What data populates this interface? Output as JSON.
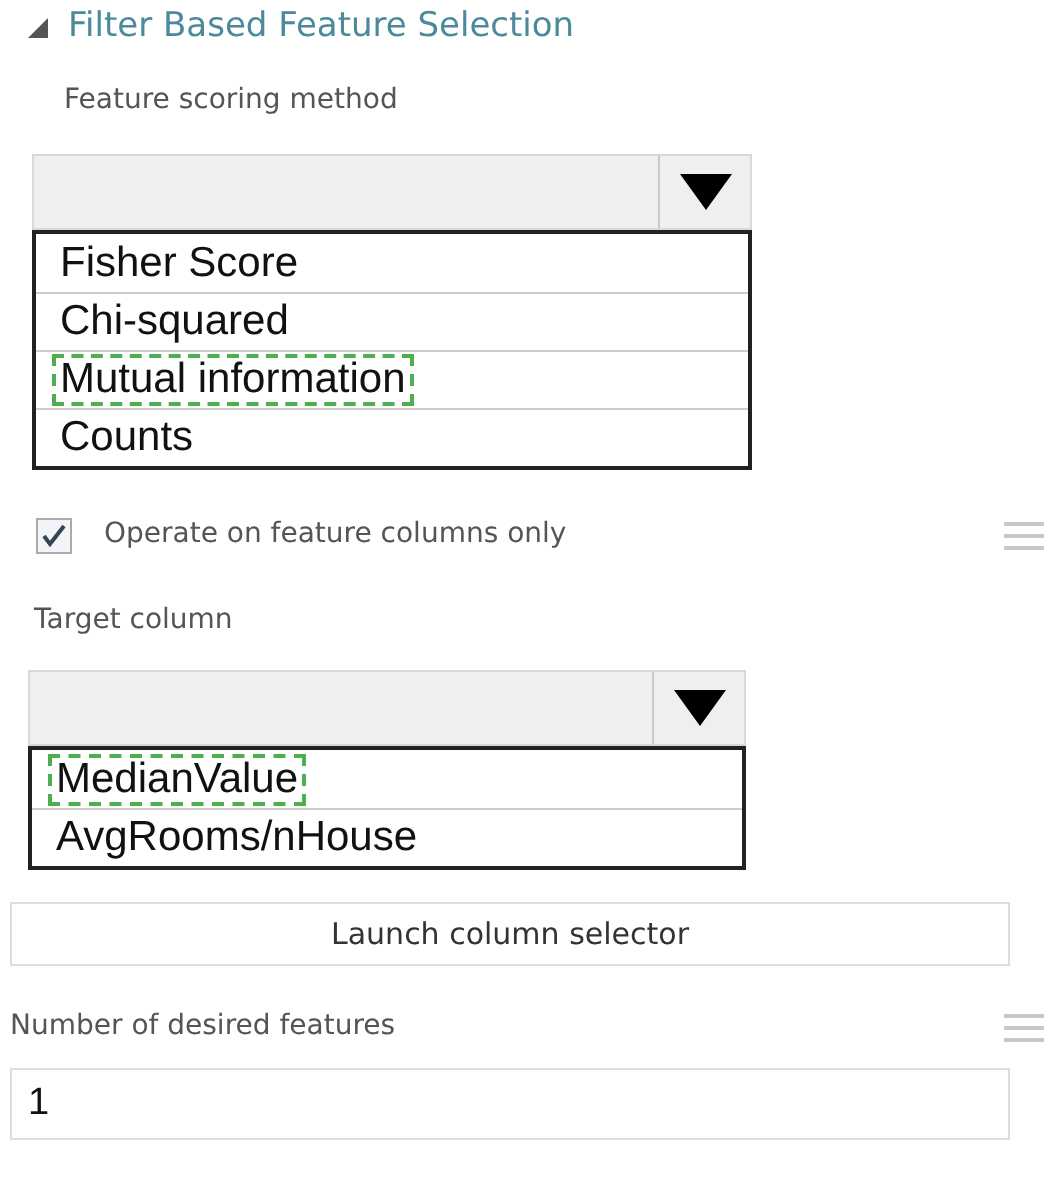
{
  "section": {
    "title": "Filter Based Feature Selection",
    "expanded": true
  },
  "scoring_method": {
    "label": "Feature scoring method",
    "options": [
      {
        "label": "Fisher Score",
        "marked": false
      },
      {
        "label": "Chi-squared",
        "marked": false
      },
      {
        "label": "Mutual information",
        "marked": true
      },
      {
        "label": "Counts",
        "marked": false
      }
    ]
  },
  "feature_columns_only": {
    "label": "Operate on feature columns only",
    "checked": true
  },
  "target_column": {
    "label": "Target column",
    "options": [
      {
        "label": "MedianValue",
        "marked": true
      },
      {
        "label": "AvgRooms/nHouse",
        "marked": false
      }
    ]
  },
  "launch_button": "Launch column selector",
  "desired_features": {
    "label": "Number of desired features",
    "value": "1"
  }
}
